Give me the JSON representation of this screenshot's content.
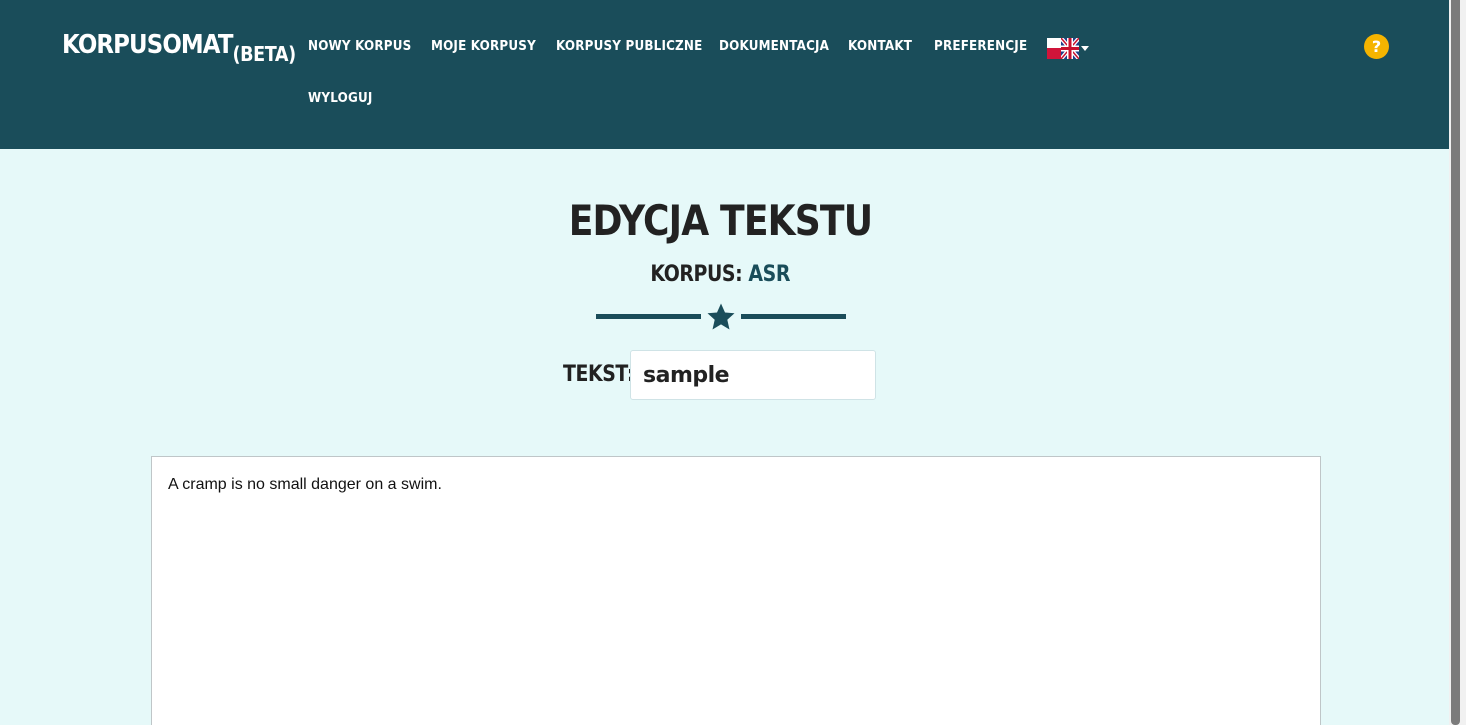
{
  "navbar": {
    "brand": "KORPUSOMAT",
    "brand_suffix": "(BETA)",
    "items": [
      {
        "label": "NOWY KORPUS"
      },
      {
        "label": "MOJE KORPUSY"
      },
      {
        "label": "KORPUSY PUBLICZNE"
      },
      {
        "label": "DOKUMENTACJA"
      },
      {
        "label": "KONTAKT"
      },
      {
        "label": "PREFERENCJE"
      },
      {
        "label": "WYLOGUJ"
      }
    ],
    "language_icon": "pl-uk-flag-icon",
    "help_label": "?",
    "background_color": "#1a4d5a",
    "help_color": "#f5b400"
  },
  "main": {
    "title": "EDYCJA TEKSTU",
    "corpus_label": "KORPUS:",
    "corpus_name": "ASR",
    "divider_icon": "star-icon",
    "text_label": "TEKST:",
    "text_name_value": "sample",
    "editor_content": "A cramp is no small danger on a swim.",
    "background_color": "#e6f9f9",
    "accent_color": "#1a4d5a"
  }
}
